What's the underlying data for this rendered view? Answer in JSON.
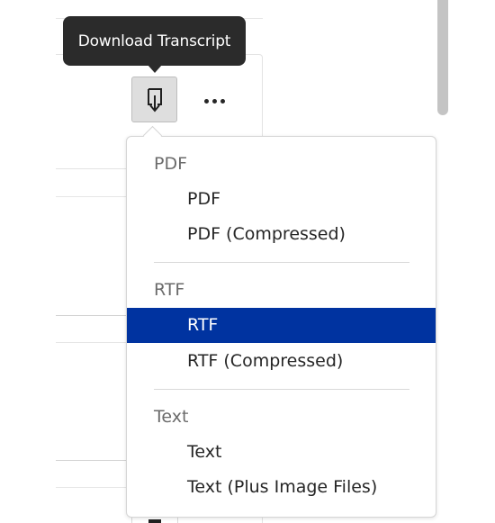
{
  "tooltip": {
    "text": "Download Transcript"
  },
  "toolbar": {
    "download_icon": "download-icon",
    "more_icon": "more-horizontal-icon"
  },
  "menu": {
    "groups": [
      {
        "header": "PDF",
        "items": [
          {
            "label": "PDF",
            "selected": false
          },
          {
            "label": "PDF (Compressed)",
            "selected": false
          }
        ]
      },
      {
        "header": "RTF",
        "items": [
          {
            "label": "RTF",
            "selected": true
          },
          {
            "label": "RTF (Compressed)",
            "selected": false
          }
        ]
      },
      {
        "header": "Text",
        "items": [
          {
            "label": "Text",
            "selected": false
          },
          {
            "label": "Text (Plus Image Files)",
            "selected": false
          }
        ]
      }
    ]
  },
  "colors": {
    "selected_background": "#0033a0",
    "tooltip_background": "#2b2b2b"
  }
}
